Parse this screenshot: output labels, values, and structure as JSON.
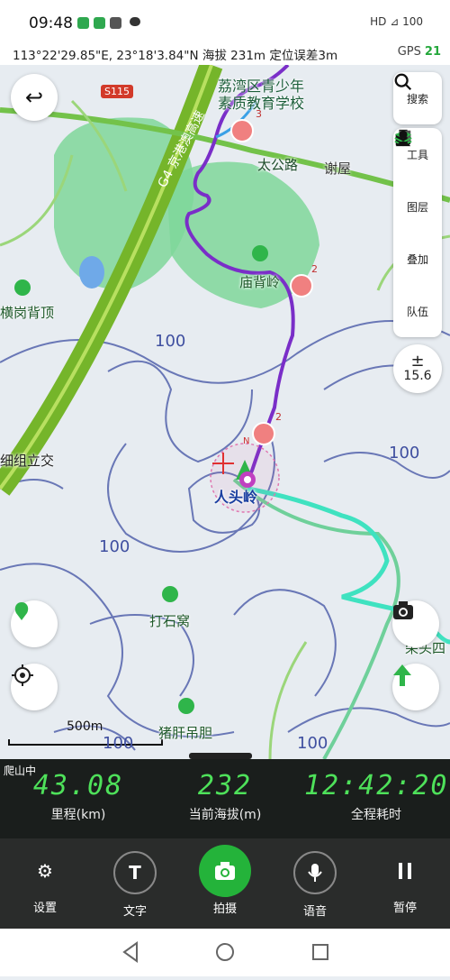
{
  "status": {
    "time": "09:48",
    "right_text": "HD ⊿ 100"
  },
  "gps_bar": {
    "coords": "113°22'29.85\"E, 23°18'3.84\"N  海拔 231m  定位误差3m",
    "gps_label": "GPS",
    "gps_count": "21"
  },
  "map": {
    "road_badge": "S115",
    "expressway": "G4 京港澳高速",
    "labels": {
      "school": "荔湾区青少年\n素质教育学校",
      "road1": "太公路",
      "village": "谢屋",
      "temple": "庙背岭",
      "peak1": "横岗背顶",
      "jiaotong": "细组立交",
      "renlou": "人头岭",
      "dashiwo": "打石窝",
      "zhugan": "猪肝吊胆",
      "right_edge": "荣头四"
    },
    "contour_labels": [
      "100",
      "100",
      "100",
      "100",
      "100"
    ],
    "scale": "500m",
    "pins": [
      "3",
      "2",
      "2"
    ],
    "north": "N"
  },
  "tools": {
    "search": "搜索",
    "tools": "工具",
    "layers": "图层",
    "overlay": "叠加",
    "team": "队伍",
    "zoom_level": "15.6"
  },
  "stats": {
    "tag": "爬山中",
    "distance_value": "43.08",
    "distance_label": "里程(km)",
    "altitude_value": "232",
    "altitude_label": "当前海拔(m)",
    "time_value": "12:42:20",
    "time_label": "全程耗时"
  },
  "actions": {
    "settings": "设置",
    "text": "文字",
    "shoot": "拍摄",
    "voice": "语音",
    "pause": "暂停"
  }
}
